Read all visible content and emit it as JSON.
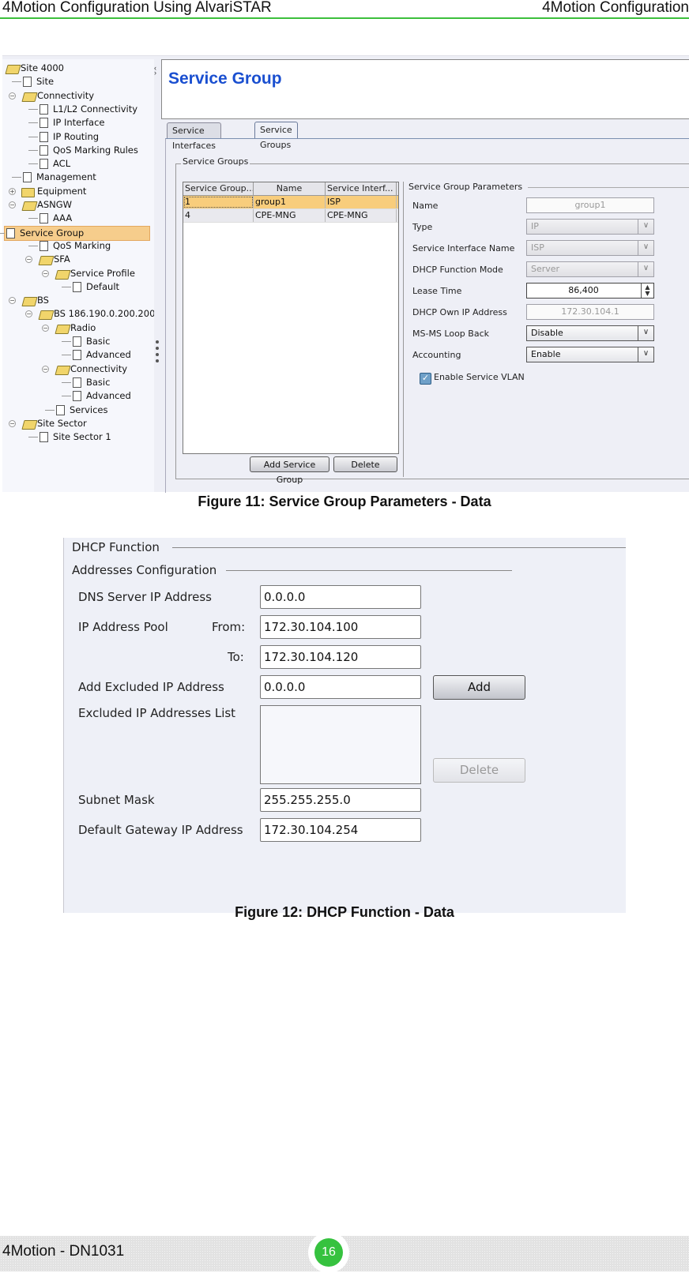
{
  "header": {
    "left": "4Motion Configuration Using AlvariSTAR",
    "right": "4Motion Configuration"
  },
  "figure11": {
    "tree": [
      {
        "label": "Site 4000",
        "icon": "folder-open-icon",
        "level": 0
      },
      {
        "label": "Site",
        "icon": "document-icon",
        "level": 1
      },
      {
        "label": "Connectivity",
        "icon": "folder-open-icon",
        "level": 1,
        "expander": "minus"
      },
      {
        "label": "L1/L2 Connectivity",
        "icon": "document-icon",
        "level": 2
      },
      {
        "label": "IP Interface",
        "icon": "document-icon",
        "level": 2
      },
      {
        "label": "IP Routing",
        "icon": "document-icon",
        "level": 2
      },
      {
        "label": "QoS Marking Rules",
        "icon": "document-icon",
        "level": 2
      },
      {
        "label": "ACL",
        "icon": "document-icon",
        "level": 2
      },
      {
        "label": "Management",
        "icon": "document-icon",
        "level": 1
      },
      {
        "label": "Equipment",
        "icon": "folder-closed-icon",
        "level": 1,
        "expander": "plus"
      },
      {
        "label": "ASNGW",
        "icon": "folder-open-icon",
        "level": 1,
        "expander": "minus"
      },
      {
        "label": "AAA",
        "icon": "document-icon",
        "level": 2
      },
      {
        "label": "Service Group",
        "icon": "document-icon",
        "level": 2,
        "selected": true
      },
      {
        "label": "QoS Marking",
        "icon": "document-icon",
        "level": 2
      },
      {
        "label": "SFA",
        "icon": "folder-open-icon",
        "level": 2,
        "expander": "minus"
      },
      {
        "label": "Service Profile",
        "icon": "folder-open-icon",
        "level": 3,
        "expander": "minus"
      },
      {
        "label": "Default",
        "icon": "document-icon",
        "level": 4
      },
      {
        "label": "BS",
        "icon": "folder-open-icon",
        "level": 1,
        "expander": "minus"
      },
      {
        "label": "BS 186.190.0.200.200.",
        "icon": "folder-open-icon",
        "level": 2,
        "expander": "minus"
      },
      {
        "label": "Radio",
        "icon": "folder-open-icon",
        "level": 3,
        "expander": "minus"
      },
      {
        "label": "Basic",
        "icon": "document-icon",
        "level": 4
      },
      {
        "label": "Advanced",
        "icon": "document-icon",
        "level": 4
      },
      {
        "label": "Connectivity",
        "icon": "folder-open-icon",
        "level": 3,
        "expander": "minus"
      },
      {
        "label": "Basic",
        "icon": "document-icon",
        "level": 4
      },
      {
        "label": "Advanced",
        "icon": "document-icon",
        "level": 4
      },
      {
        "label": "Services",
        "icon": "document-icon",
        "level": 3
      },
      {
        "label": "Site Sector",
        "icon": "folder-open-icon",
        "level": 1,
        "expander": "minus"
      },
      {
        "label": "Site Sector 1",
        "icon": "document-icon",
        "level": 2
      }
    ],
    "title": "Service Group",
    "tabs": [
      {
        "label": "Service Interfaces",
        "active": false
      },
      {
        "label": "Service Groups",
        "active": true
      }
    ],
    "group_title": "Service Groups",
    "table": {
      "columns": [
        "Service Group...",
        "Name",
        "Service Interf..."
      ],
      "rows": [
        [
          "1",
          "group1",
          "ISP"
        ],
        [
          "4",
          "CPE-MNG",
          "CPE-MNG"
        ]
      ]
    },
    "buttons": {
      "add": "Add Service Group",
      "delete": "Delete"
    },
    "params": {
      "title": "Service Group Parameters",
      "name_label": "Name",
      "name_value": "group1",
      "type_label": "Type",
      "type_value": "IP",
      "sif_label": "Service Interface Name",
      "sif_value": "ISP",
      "dhcp_mode_label": "DHCP Function Mode",
      "dhcp_mode_value": "Server",
      "lease_label": "Lease Time",
      "lease_value": "86,400",
      "own_ip_label": "DHCP Own IP Address",
      "own_ip_value": "172.30.104.1",
      "loopback_label": "MS-MS Loop Back",
      "loopback_value": "Disable",
      "accounting_label": "Accounting",
      "accounting_value": "Enable",
      "vlan_label": "Enable Service VLAN",
      "vlan_checked": true
    },
    "caption": "Figure 11: Service Group Parameters - Data"
  },
  "figure12": {
    "section1": "DHCP Function",
    "section2": "Addresses Configuration",
    "dns_label": "DNS Server IP Address",
    "dns_value": "0.0.0.0",
    "pool_label": "IP Address Pool",
    "from_label": "From:",
    "from_value": "172.30.104.100",
    "to_label": "To:",
    "to_value": "172.30.104.120",
    "excl_add_label": "Add Excluded IP Address",
    "excl_add_value": "0.0.0.0",
    "add_button": "Add",
    "excl_list_label": "Excluded IP Addresses List",
    "delete_button": "Delete",
    "mask_label": "Subnet Mask",
    "mask_value": "255.255.255.0",
    "gw_label": "Default Gateway IP Address",
    "gw_value": "172.30.104.254",
    "caption": "Figure 12: DHCP Function - Data"
  },
  "footer": {
    "doc": "4Motion - DN1031",
    "page": "16"
  }
}
